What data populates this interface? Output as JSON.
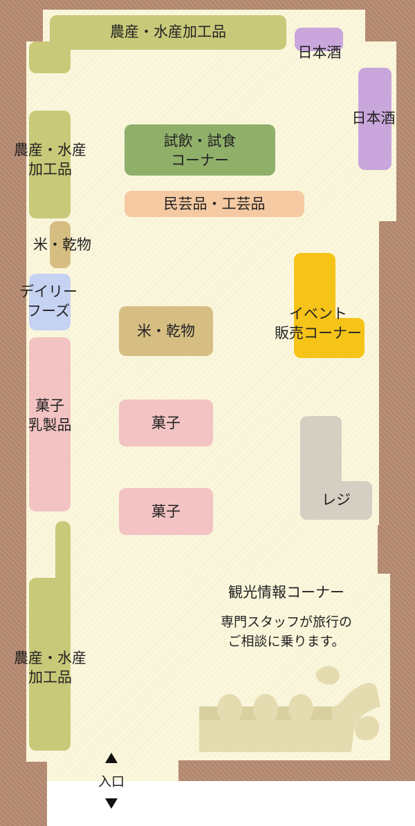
{
  "map": {
    "sections": {
      "produce_top": "農産・水産加工品",
      "sake_top": "日本酒",
      "sake_right": "日本酒",
      "produce_left_1": "農産・水産",
      "produce_left_2": "加工品",
      "tasting_1": "試飲・試食",
      "tasting_2": "コーナー",
      "crafts": "民芸品・工芸品",
      "rice_left": "米・乾物",
      "daily_1": "デイリー",
      "daily_2": "フーズ",
      "rice_center": "米・乾物",
      "event_1": "イベント",
      "event_2": "販売コーナー",
      "sweets_dairy_1": "菓子",
      "sweets_dairy_2": "乳製品",
      "sweets_1": "菓子",
      "register": "レジ",
      "sweets_2": "菓子",
      "info_title": "観光情報コーナー",
      "info_desc_1": "専門スタッフが旅行の",
      "info_desc_2": "ご相談に乗ります。",
      "produce_bottom_1": "農産・水産",
      "produce_bottom_2": "加工品"
    },
    "entrance": "入口"
  },
  "colors": {
    "wall": "#b88b72",
    "floor": "#fbf7dc",
    "produce": "#c9c97a",
    "sake": "#c9a6dc",
    "tasting": "#90b06a",
    "crafts": "#f5c9a2",
    "rice": "#d6be83",
    "daily": "#c6d2f2",
    "sweets": "#f3c3c3",
    "event": "#f6c419",
    "register": "#d4cfc2",
    "info_furniture": "#e4dcb0"
  },
  "icons": {
    "entrance_up": "arrow-up-icon",
    "entrance_down": "arrow-down-icon"
  }
}
